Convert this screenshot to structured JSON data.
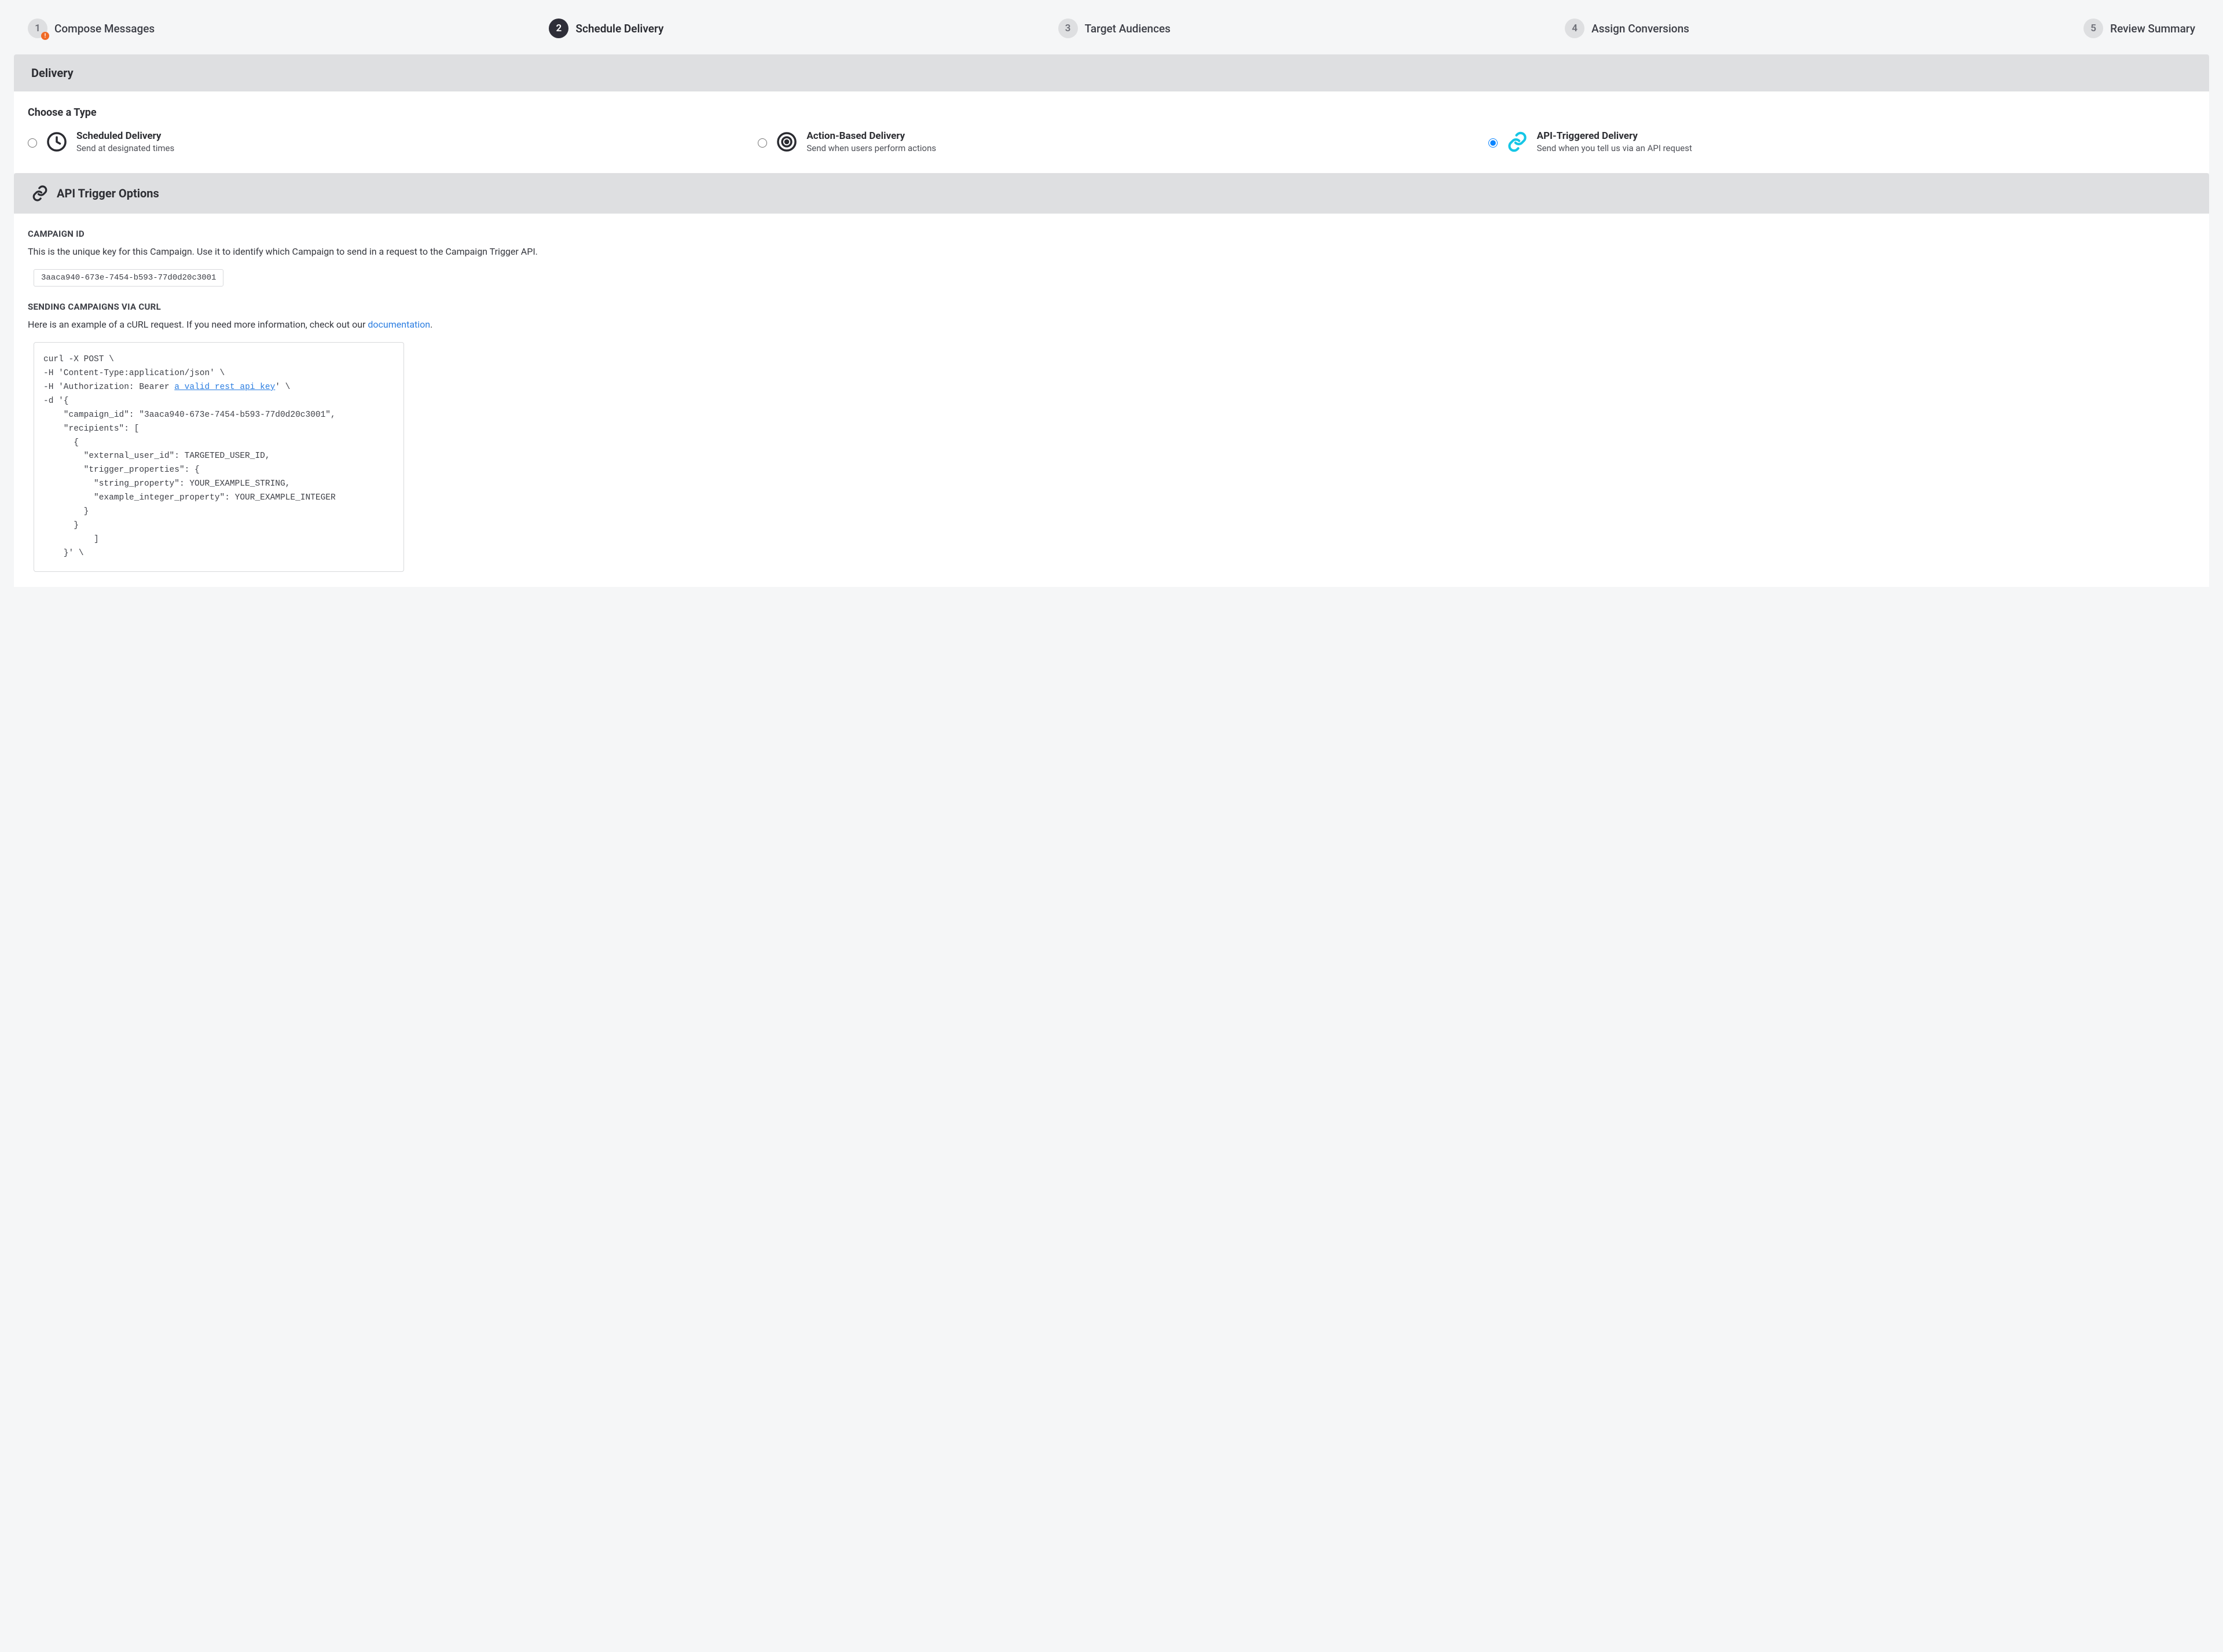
{
  "stepper": {
    "steps": [
      {
        "num": "1",
        "label": "Compose Messages",
        "warn": true
      },
      {
        "num": "2",
        "label": "Schedule Delivery",
        "active": true
      },
      {
        "num": "3",
        "label": "Target Audiences"
      },
      {
        "num": "4",
        "label": "Assign Conversions"
      },
      {
        "num": "5",
        "label": "Review Summary"
      }
    ]
  },
  "delivery": {
    "header": "Delivery",
    "choose_label": "Choose a Type",
    "options": {
      "scheduled": {
        "title": "Scheduled Delivery",
        "desc": "Send at designated times"
      },
      "action": {
        "title": "Action-Based Delivery",
        "desc": "Send when users perform actions"
      },
      "api": {
        "title": "API-Triggered Delivery",
        "desc": "Send when you tell us via an API request"
      }
    }
  },
  "api_trigger": {
    "header": "API Trigger Options",
    "campaign_id_label": "CAMPAIGN ID",
    "campaign_id_desc": "This is the unique key for this Campaign. Use it to identify which Campaign to send in a request to the Campaign Trigger API.",
    "campaign_id_value": "3aaca940-673e-7454-b593-77d0d20c3001",
    "curl_label": "SENDING CAMPAIGNS VIA CURL",
    "curl_desc_prefix": "Here is an example of a cURL request. If you need more information, check out our ",
    "curl_desc_link": "documentation",
    "curl_desc_suffix": ".",
    "curl_lines": {
      "l1": "curl -X POST \\",
      "l2": "-H 'Content-Type:application/json' \\",
      "l3a": "-H 'Authorization: Bearer ",
      "l3b": "a valid rest api key",
      "l3c": "' \\",
      "l4": "-d '{",
      "l5": "    \"campaign_id\": \"3aaca940-673e-7454-b593-77d0d20c3001\",",
      "l6": "    \"recipients\": [",
      "l7": "      {",
      "l8": "        \"external_user_id\": TARGETED_USER_ID,",
      "l9": "        \"trigger_properties\": {",
      "l10": "          \"string_property\": YOUR_EXAMPLE_STRING,",
      "l11": "          \"example_integer_property\": YOUR_EXAMPLE_INTEGER",
      "l12": "        }",
      "l13": "      }",
      "l14": "          ]",
      "l15": "    }' \\"
    }
  }
}
